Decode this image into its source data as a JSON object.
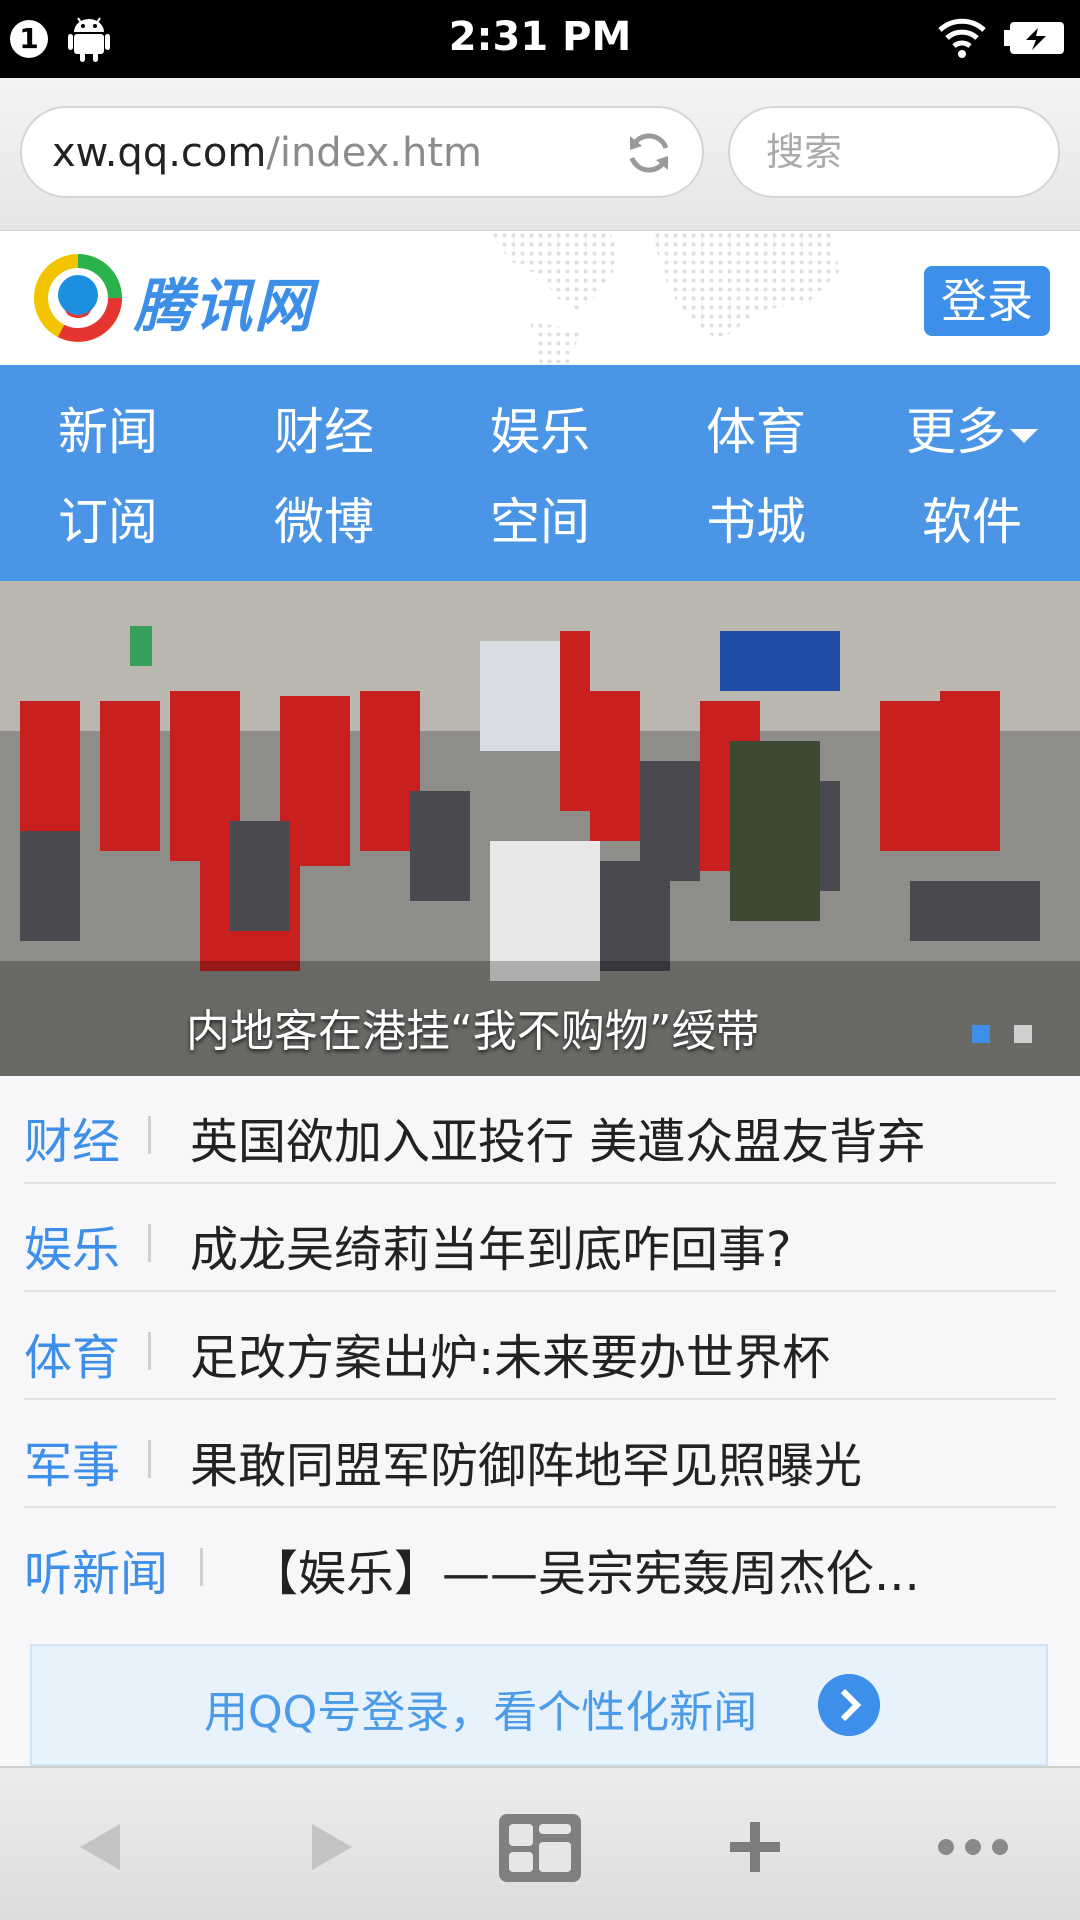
{
  "status_bar": {
    "notification_count": "1",
    "time": "2:31 PM",
    "icons": [
      "android-icon",
      "wifi-icon",
      "battery-icon"
    ]
  },
  "browser": {
    "url_host": "xw.qq.com",
    "url_path": "/index.htm",
    "search_placeholder": "搜索"
  },
  "site": {
    "logo_text": "腾讯网",
    "login_label": "登录",
    "brand_color": "#3d8fea"
  },
  "nav": {
    "row1": [
      "新闻",
      "财经",
      "娱乐",
      "体育",
      "更多"
    ],
    "row2": [
      "订阅",
      "微博",
      "空间",
      "书城",
      "软件"
    ]
  },
  "hero": {
    "caption": "内地客在港挂“我不购物”绶带",
    "slides": 2,
    "active_slide": 1
  },
  "news": [
    {
      "category": "财经",
      "title": "英国欲加入亚投行 美遭众盟友背弃"
    },
    {
      "category": "娱乐",
      "title": "成龙吴绮莉当年到底咋回事?"
    },
    {
      "category": "体育",
      "title": "足改方案出炉:未来要办世界杯"
    },
    {
      "category": "军事",
      "title": "果敢同盟军防御阵地罕见照曝光"
    },
    {
      "category": "听新闻",
      "title": "【娱乐】——吴宗宪轰周杰伦..."
    }
  ],
  "promo": {
    "text": "用QQ号登录，看个性化新闻"
  },
  "toolbar": {
    "icons": [
      "back-icon",
      "forward-icon",
      "tabs-icon",
      "add-icon",
      "more-icon"
    ]
  }
}
